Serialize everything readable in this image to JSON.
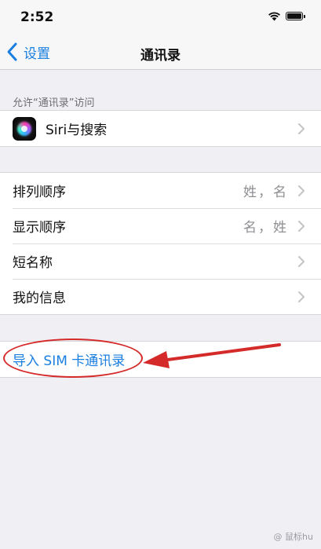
{
  "status_bar": {
    "time": "2:52",
    "wifi_icon": "wifi-icon",
    "battery_icon": "battery-icon"
  },
  "nav": {
    "back_label": "设置",
    "title": "通讯录",
    "back_icon": "chevron-left-icon"
  },
  "section_header": "允许“通讯录”访问",
  "group1": [
    {
      "icon": "siri-icon",
      "label": "Siri与搜索"
    }
  ],
  "group2": [
    {
      "label": "排列顺序",
      "value": "姓，名"
    },
    {
      "label": "显示顺序",
      "value": "名，姓"
    },
    {
      "label": "短名称",
      "value": ""
    },
    {
      "label": "我的信息",
      "value": ""
    }
  ],
  "group3": [
    {
      "label": "导入 SIM 卡通讯录"
    }
  ],
  "annotation": {
    "color": "#d42a2a"
  },
  "accent_color": "#1a7fe0",
  "watermark": "@ 鼠标hu"
}
